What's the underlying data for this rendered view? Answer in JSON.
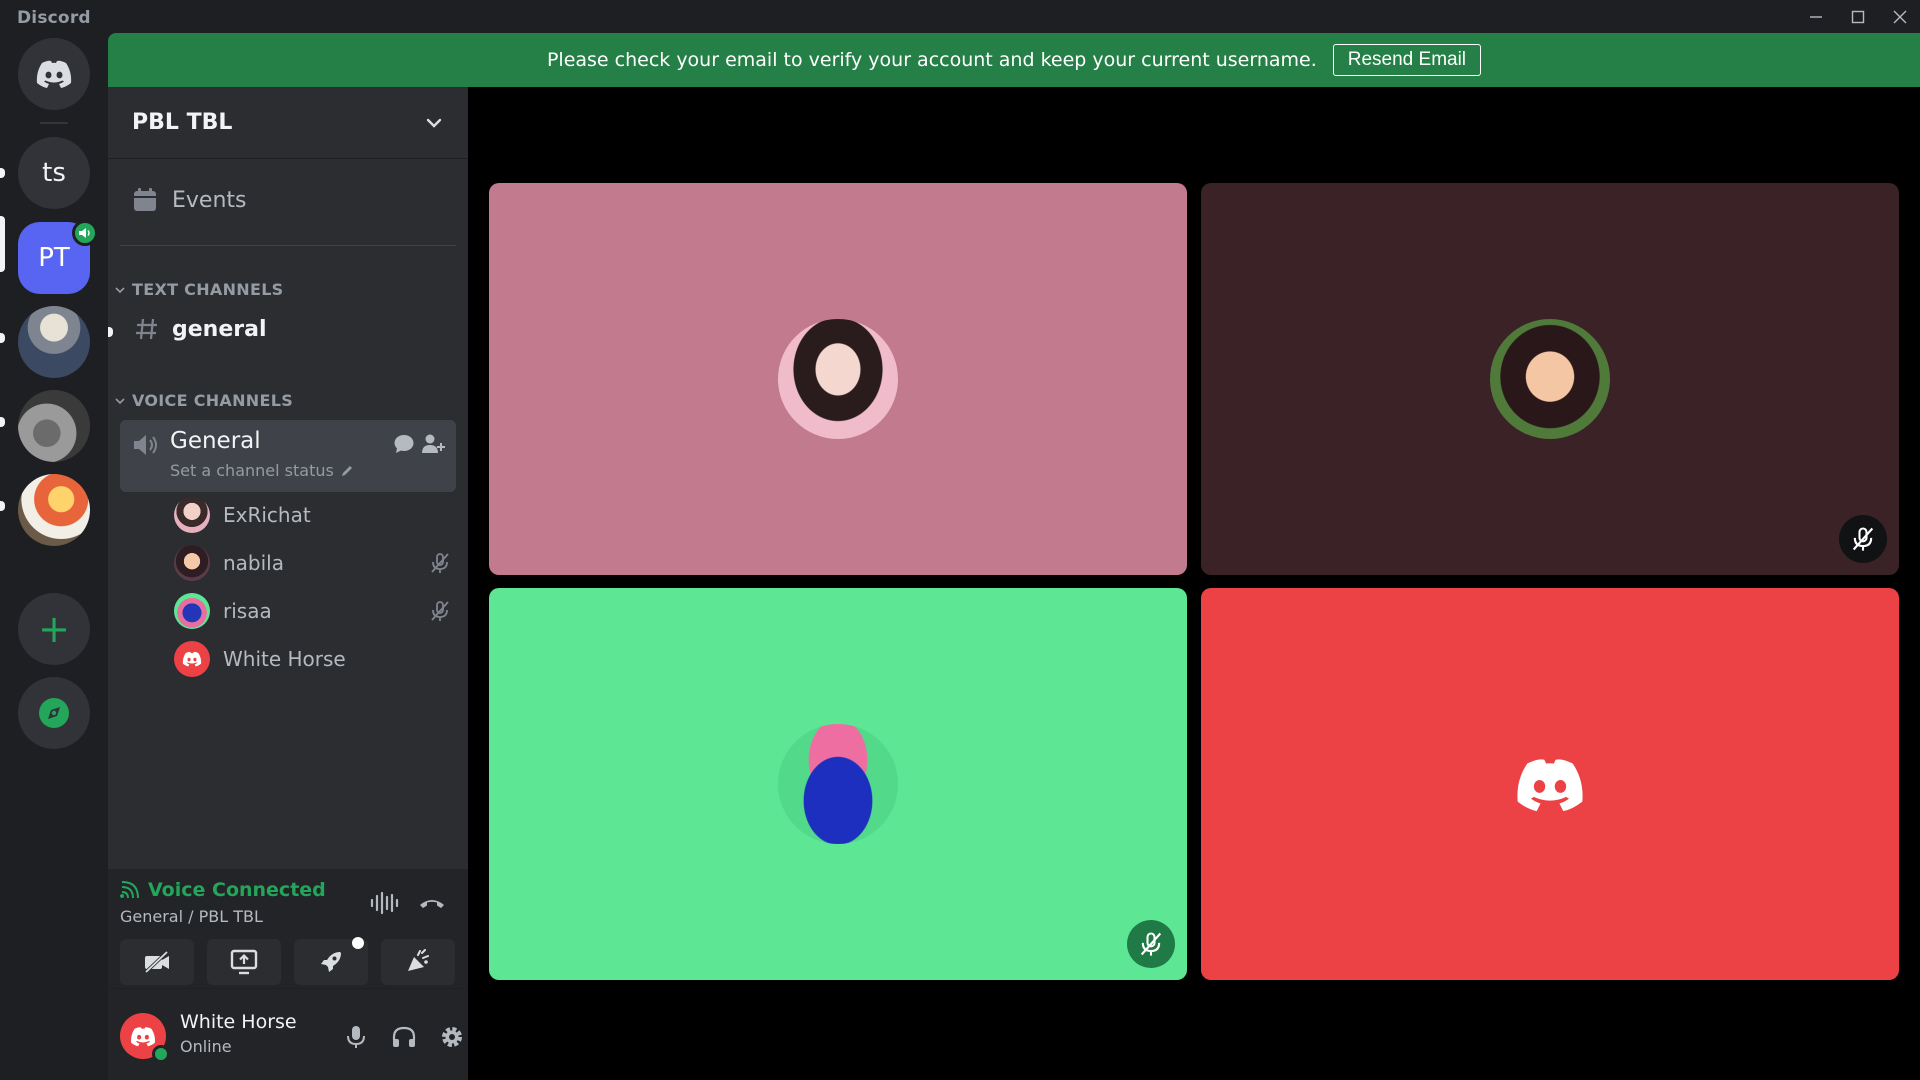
{
  "window": {
    "brand": "Discord",
    "controls": [
      "minimize-icon",
      "maximize-icon",
      "close-icon"
    ]
  },
  "notice": {
    "text": "Please check your email to verify your account and keep your current username.",
    "button": "Resend Email",
    "color": "#248046"
  },
  "rail": {
    "servers": [
      {
        "name": "home",
        "icon": "discord-logo-icon"
      },
      {
        "name": "ts",
        "label": "ts"
      },
      {
        "name": "PBL TBL",
        "label": "PT",
        "active": true,
        "badge": "speaker-icon"
      },
      {
        "name": "server-photo-1",
        "icon": "server-photo"
      },
      {
        "name": "server-photo-2",
        "icon": "server-photo"
      },
      {
        "name": "server-photo-3",
        "icon": "server-photo"
      }
    ],
    "add": "+",
    "discover": "compass-icon"
  },
  "guild": {
    "name": "PBL TBL",
    "events": "Events",
    "text_category": "TEXT CHANNELS",
    "voice_category": "VOICE CHANNELS",
    "text_channels": [
      {
        "name": "general",
        "unread": true
      }
    ],
    "voice_channel": {
      "name": "General",
      "status": "Set a channel status",
      "members": [
        {
          "name": "ExRichat",
          "muted": false
        },
        {
          "name": "nabila",
          "muted": true
        },
        {
          "name": "risaa",
          "muted": true
        },
        {
          "name": "White Horse",
          "muted": false
        }
      ]
    }
  },
  "voice_panel": {
    "status": "Voice Connected",
    "location": "General / PBL TBL"
  },
  "user": {
    "name": "White Horse",
    "status": "Online"
  },
  "tiles": [
    {
      "user": "ExRichat",
      "bg": "#c27b8e",
      "muted": false
    },
    {
      "user": "nabila",
      "bg": "#3a2226",
      "muted": true
    },
    {
      "user": "risaa",
      "bg": "#5de694",
      "muted": true
    },
    {
      "user": "White Horse",
      "bg": "#ed4245",
      "muted": false
    }
  ],
  "colors": {
    "accent": "#5865f2",
    "green": "#23a55a",
    "red": "#ed4245"
  }
}
